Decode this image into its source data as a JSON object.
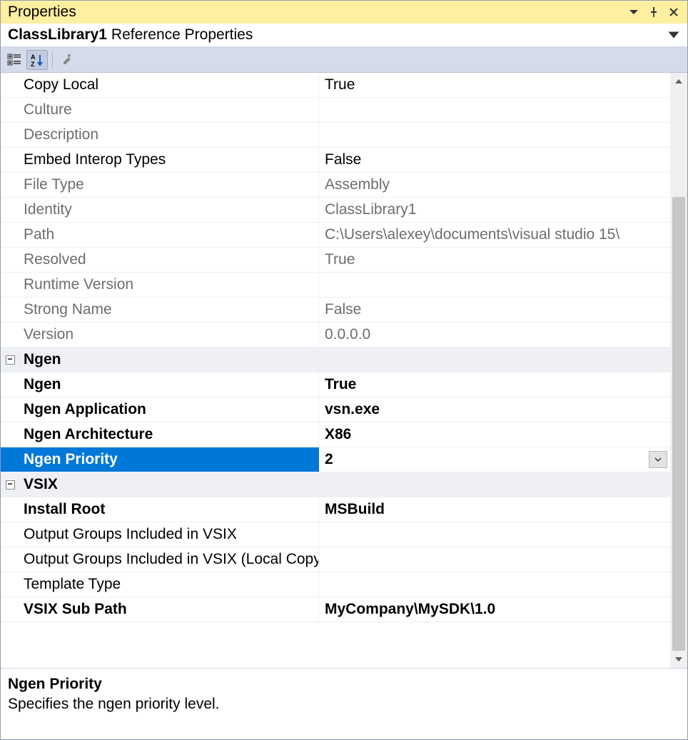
{
  "window": {
    "title": "Properties"
  },
  "subtitle": {
    "object_name": "ClassLibrary1",
    "suffix": "Reference Properties"
  },
  "rows": [
    {
      "kind": "prop",
      "name": "Copy Local",
      "value": "True",
      "readonly": false,
      "bold": false
    },
    {
      "kind": "prop",
      "name": "Culture",
      "value": "",
      "readonly": true,
      "bold": false
    },
    {
      "kind": "prop",
      "name": "Description",
      "value": "",
      "readonly": true,
      "bold": false
    },
    {
      "kind": "prop",
      "name": "Embed Interop Types",
      "value": "False",
      "readonly": false,
      "bold": false
    },
    {
      "kind": "prop",
      "name": "File Type",
      "value": "Assembly",
      "readonly": true,
      "bold": false
    },
    {
      "kind": "prop",
      "name": "Identity",
      "value": "ClassLibrary1",
      "readonly": true,
      "bold": false
    },
    {
      "kind": "prop",
      "name": "Path",
      "value": "C:\\Users\\alexey\\documents\\visual studio 15\\",
      "readonly": true,
      "bold": false
    },
    {
      "kind": "prop",
      "name": "Resolved",
      "value": "True",
      "readonly": true,
      "bold": false
    },
    {
      "kind": "prop",
      "name": "Runtime Version",
      "value": "",
      "readonly": true,
      "bold": false
    },
    {
      "kind": "prop",
      "name": "Strong Name",
      "value": "False",
      "readonly": true,
      "bold": false
    },
    {
      "kind": "prop",
      "name": "Version",
      "value": "0.0.0.0",
      "readonly": true,
      "bold": false
    },
    {
      "kind": "cat",
      "name": "Ngen"
    },
    {
      "kind": "prop",
      "name": "Ngen",
      "value": "True",
      "readonly": false,
      "bold": true
    },
    {
      "kind": "prop",
      "name": "Ngen Application",
      "value": "vsn.exe",
      "readonly": false,
      "bold": true
    },
    {
      "kind": "prop",
      "name": "Ngen Architecture",
      "value": "X86",
      "readonly": false,
      "bold": true
    },
    {
      "kind": "prop",
      "name": "Ngen Priority",
      "value": "2",
      "readonly": false,
      "bold": true,
      "selected": true,
      "dropdown": true
    },
    {
      "kind": "cat",
      "name": "VSIX"
    },
    {
      "kind": "prop",
      "name": "Install Root",
      "value": "MSBuild",
      "readonly": false,
      "bold": true
    },
    {
      "kind": "prop",
      "name": "Output Groups Included in VSIX",
      "value": "",
      "readonly": false,
      "bold": false
    },
    {
      "kind": "prop",
      "name": "Output Groups Included in VSIX (Local Copy)",
      "value": "",
      "readonly": false,
      "bold": false
    },
    {
      "kind": "prop",
      "name": "Template Type",
      "value": "",
      "readonly": false,
      "bold": false
    },
    {
      "kind": "prop",
      "name": "VSIX Sub Path",
      "value": "MyCompany\\MySDK\\1.0",
      "readonly": false,
      "bold": true
    }
  ],
  "description": {
    "title": "Ngen Priority",
    "text": "Specifies the ngen priority level."
  }
}
